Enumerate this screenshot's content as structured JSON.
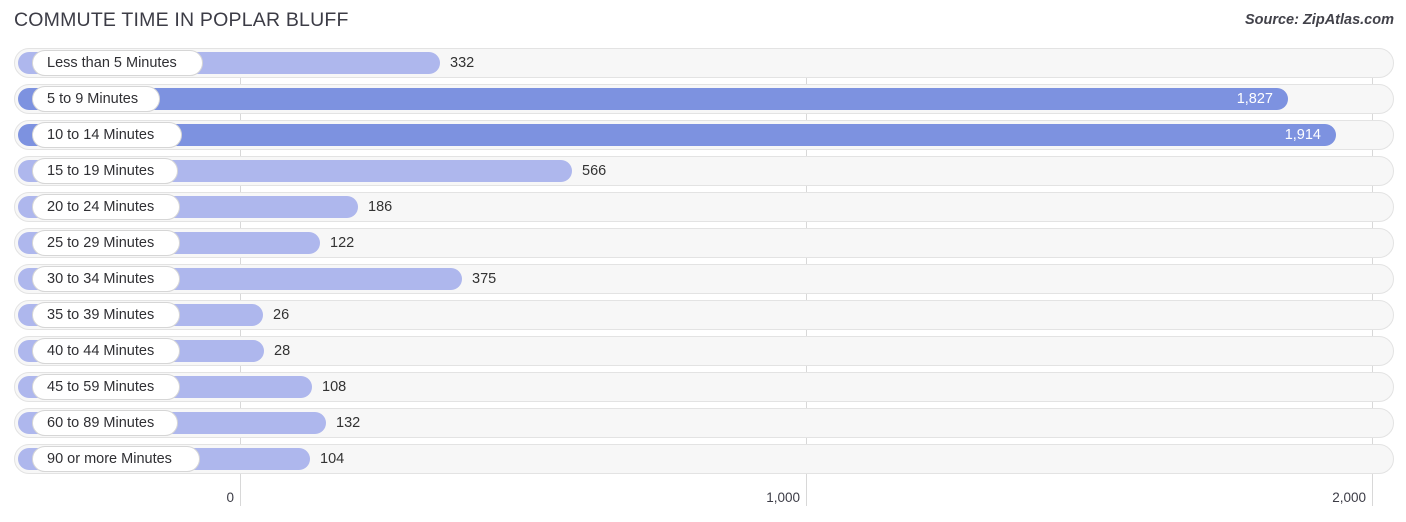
{
  "header": {
    "title": "COMMUTE TIME IN POPLAR BLUFF",
    "source": "Source: ZipAtlas.com"
  },
  "colors": {
    "bar_light": "#aeb7ed",
    "bar_strong": "#7d92e0",
    "track": "#f7f7f7",
    "gridline": "#d8d8d8",
    "text": "#333333"
  },
  "chart_data": {
    "type": "bar",
    "orientation": "horizontal",
    "title": "COMMUTE TIME IN POPLAR BLUFF",
    "xlabel": "",
    "ylabel": "",
    "xlim": [
      0,
      2000
    ],
    "grid": true,
    "legend": null,
    "xticks": [
      0,
      1000,
      2000
    ],
    "xtick_labels": [
      "0",
      "1,000",
      "2,000"
    ],
    "categories": [
      "Less than 5 Minutes",
      "5 to 9 Minutes",
      "10 to 14 Minutes",
      "15 to 19 Minutes",
      "20 to 24 Minutes",
      "25 to 29 Minutes",
      "30 to 34 Minutes",
      "35 to 39 Minutes",
      "40 to 44 Minutes",
      "45 to 59 Minutes",
      "60 to 89 Minutes",
      "90 or more Minutes"
    ],
    "values": [
      332,
      1827,
      1914,
      566,
      186,
      122,
      375,
      26,
      28,
      108,
      132,
      104
    ],
    "value_labels": [
      "332",
      "1,827",
      "1,914",
      "566",
      "186",
      "122",
      "375",
      "26",
      "28",
      "108",
      "132",
      "104"
    ]
  },
  "rows": [
    {
      "label": "Less than 5 Minutes",
      "value": 332,
      "value_label": "332",
      "bar_end": 440,
      "label_end": 203,
      "strong": false,
      "inside": false
    },
    {
      "label": "5 to 9 Minutes",
      "value": 1827,
      "value_label": "1,827",
      "bar_end": 1288,
      "label_end": 160,
      "strong": true,
      "inside": true
    },
    {
      "label": "10 to 14 Minutes",
      "value": 1914,
      "value_label": "1,914",
      "bar_end": 1336,
      "label_end": 182,
      "strong": true,
      "inside": true
    },
    {
      "label": "15 to 19 Minutes",
      "value": 566,
      "value_label": "566",
      "bar_end": 572,
      "label_end": 178,
      "strong": false,
      "inside": false
    },
    {
      "label": "20 to 24 Minutes",
      "value": 186,
      "value_label": "186",
      "bar_end": 358,
      "label_end": 180,
      "strong": false,
      "inside": false
    },
    {
      "label": "25 to 29 Minutes",
      "value": 122,
      "value_label": "122",
      "bar_end": 320,
      "label_end": 180,
      "strong": false,
      "inside": false
    },
    {
      "label": "30 to 34 Minutes",
      "value": 375,
      "value_label": "375",
      "bar_end": 462,
      "label_end": 180,
      "strong": false,
      "inside": false
    },
    {
      "label": "35 to 39 Minutes",
      "value": 26,
      "value_label": "26",
      "bar_end": 263,
      "label_end": 180,
      "strong": false,
      "inside": false
    },
    {
      "label": "40 to 44 Minutes",
      "value": 28,
      "value_label": "28",
      "bar_end": 264,
      "label_end": 180,
      "strong": false,
      "inside": false
    },
    {
      "label": "45 to 59 Minutes",
      "value": 108,
      "value_label": "108",
      "bar_end": 312,
      "label_end": 180,
      "strong": false,
      "inside": false
    },
    {
      "label": "60 to 89 Minutes",
      "value": 132,
      "value_label": "132",
      "bar_end": 326,
      "label_end": 178,
      "strong": false,
      "inside": false
    },
    {
      "label": "90 or more Minutes",
      "value": 104,
      "value_label": "104",
      "bar_end": 310,
      "label_end": 200,
      "strong": false,
      "inside": false
    }
  ],
  "axis": {
    "ticks": [
      {
        "label": "0",
        "x": 240
      },
      {
        "label": "1,000",
        "x": 806
      },
      {
        "label": "2,000",
        "x": 1372
      }
    ]
  }
}
